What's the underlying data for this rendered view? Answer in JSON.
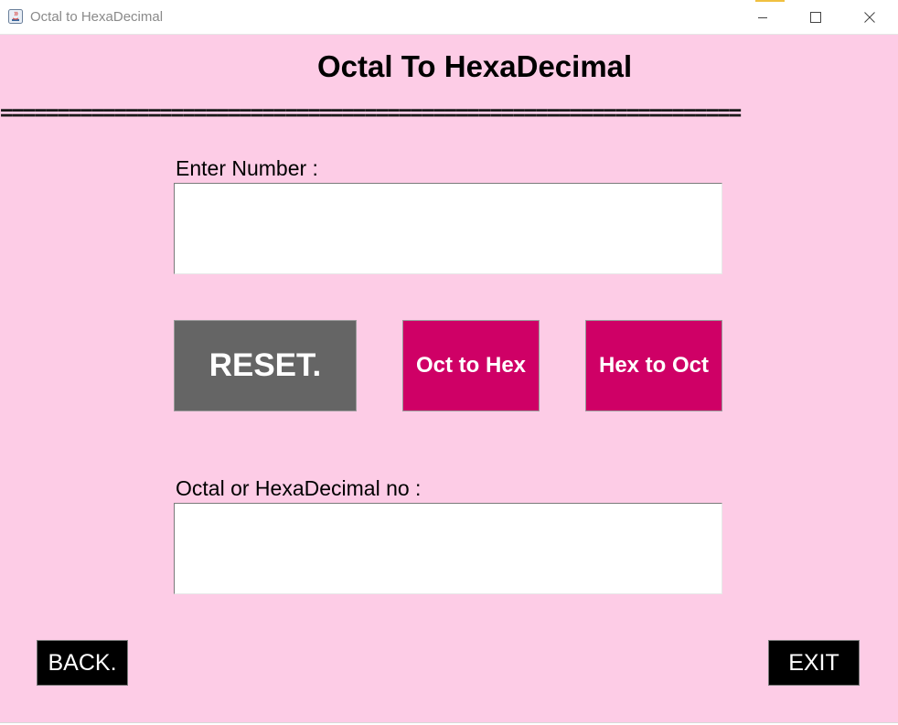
{
  "window": {
    "title": "Octal to HexaDecimal",
    "icon": "java-app-icon",
    "controls": [
      "minimize-icon",
      "maximize-icon",
      "close-icon"
    ]
  },
  "main": {
    "heading": "Octal To HexaDecimal",
    "separator": "=================================================================",
    "input_label": "Enter Number :",
    "input_value": "",
    "output_label": "Octal or HexaDecimal no :",
    "output_value": ""
  },
  "buttons": {
    "reset": "RESET.",
    "oct_to_hex": "Oct to Hex",
    "hex_to_oct": "Hex to Oct",
    "back": "BACK.",
    "exit": "EXIT"
  },
  "colors": {
    "background": "#fdcce6",
    "reset_button": "#656565",
    "action_button": "#cf0066",
    "nav_button": "#000000"
  }
}
